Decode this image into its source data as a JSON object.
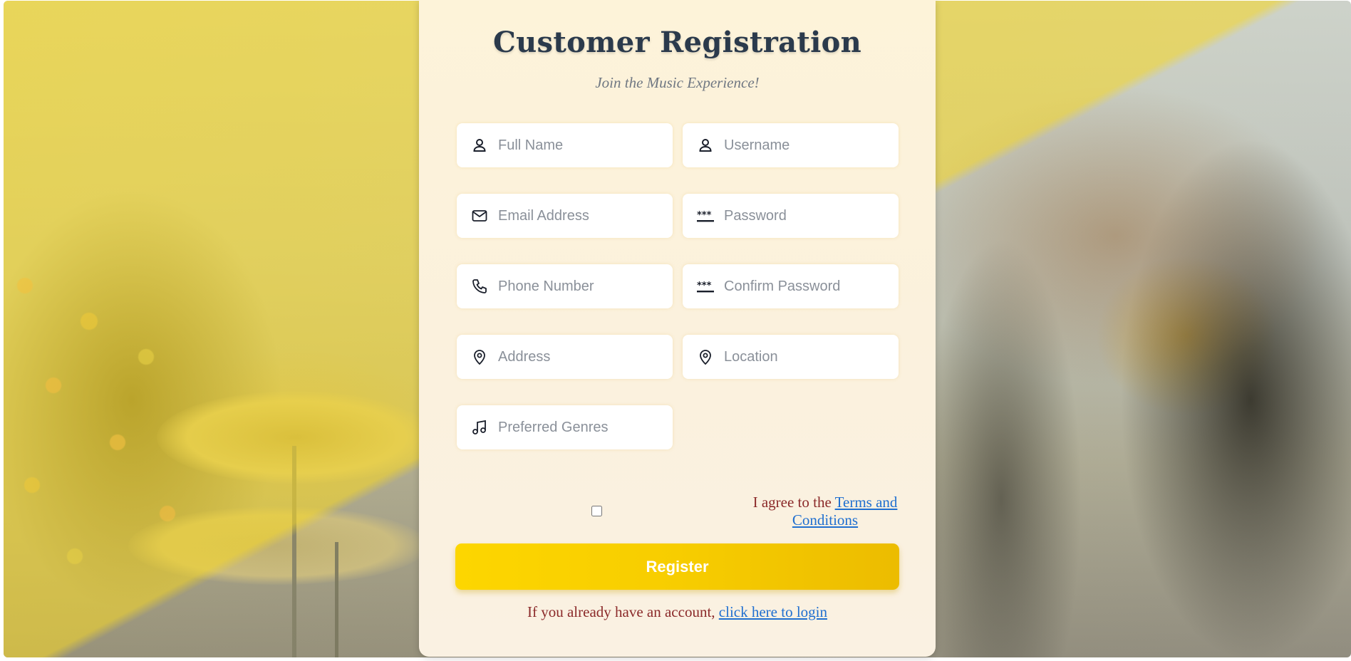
{
  "form": {
    "title": "Customer Registration",
    "subtitle": "Join the Music Experience!",
    "fields": {
      "full_name": "Full Name",
      "username": "Username",
      "email": "Email Address",
      "password": "Password",
      "phone": "Phone Number",
      "confirm_password": "Confirm Password",
      "address": "Address",
      "location": "Location",
      "genres": "Preferred Genres"
    },
    "terms_prefix": "I agree to the ",
    "terms_link": "Terms and Conditions",
    "register_label": "Register",
    "login_prefix": "If you already have an account, ",
    "login_link": "click here to login"
  },
  "icons": {
    "full_name": "user-icon",
    "username": "user-icon",
    "email": "mail-icon",
    "password": "password-icon",
    "phone": "phone-icon",
    "confirm_password": "password-icon",
    "address": "map-pin-icon",
    "location": "map-pin-icon",
    "genres": "music-note-icon"
  },
  "colors": {
    "accent": "#fdd600",
    "title": "#2b3a4c",
    "link": "#1f6fd0",
    "prompt_text": "#8b2a2a"
  }
}
